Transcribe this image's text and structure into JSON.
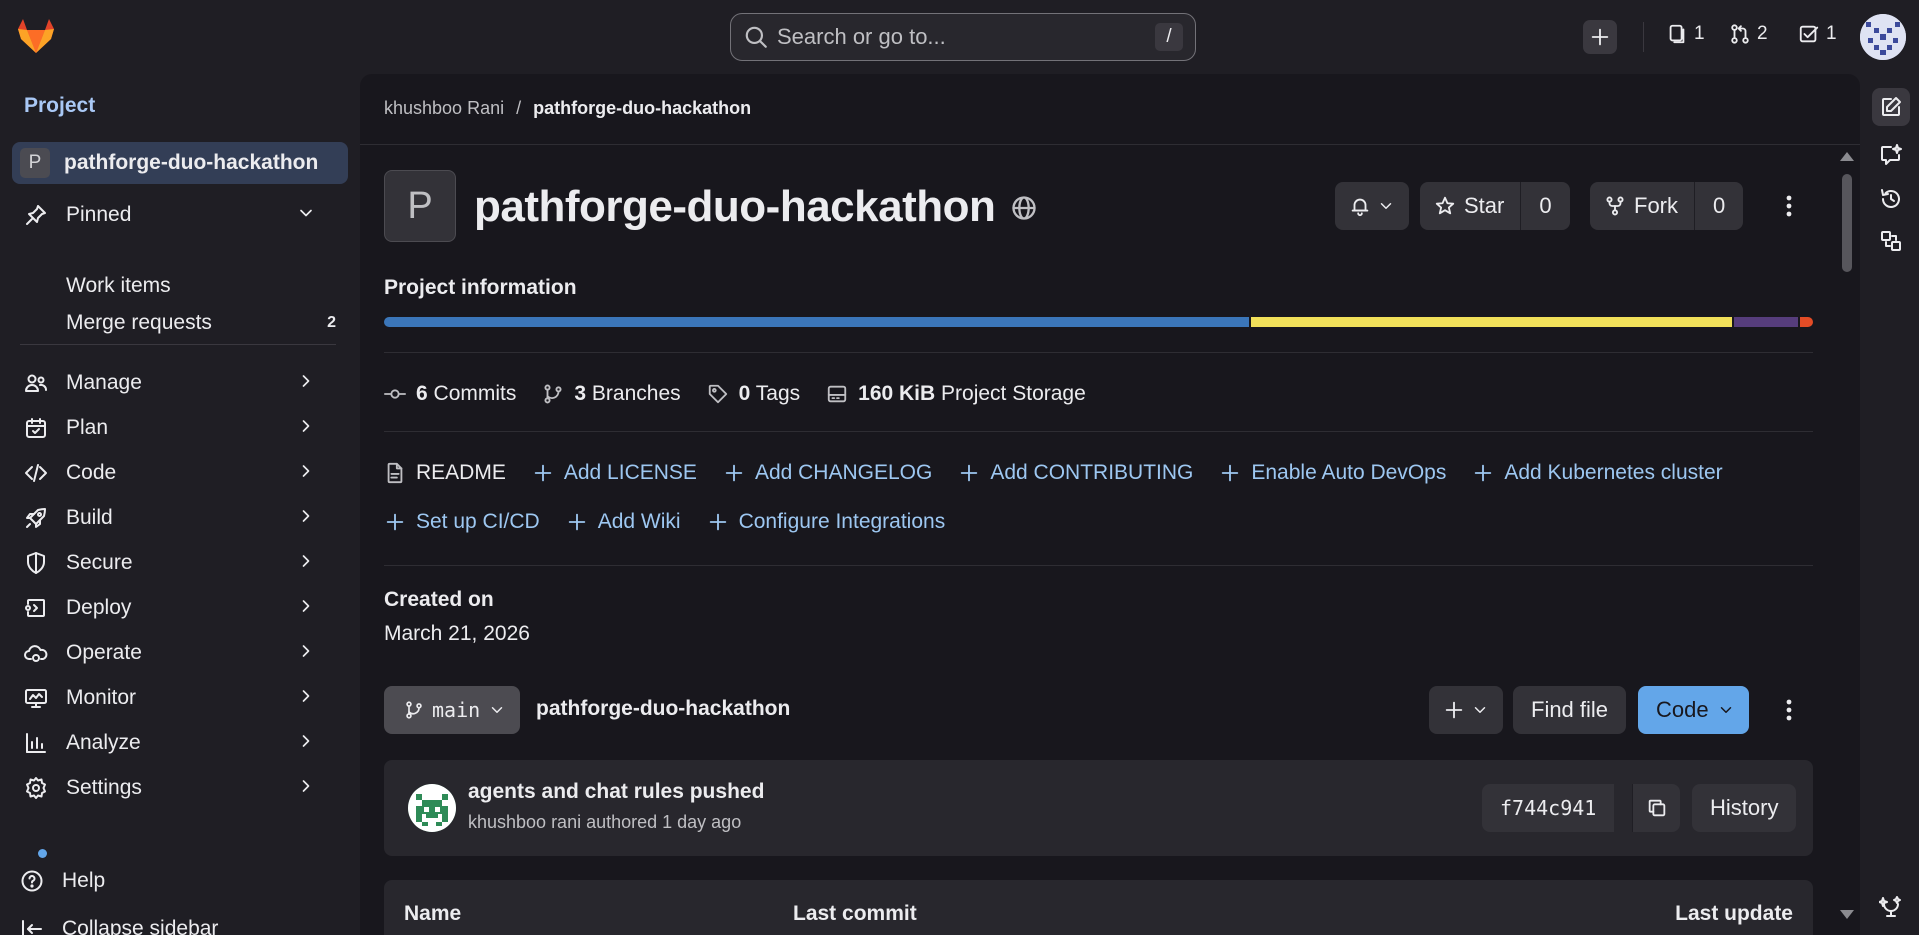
{
  "topbar": {
    "search_placeholder": "Search or go to...",
    "search_shortcut": "/",
    "issues_count": "1",
    "merge_requests_count": "2",
    "todos_count": "1"
  },
  "sidebar": {
    "heading": "Project",
    "project_name": "pathforge-duo-hackathon",
    "project_initial": "P",
    "pinned": {
      "label": "Pinned",
      "items": [
        {
          "label": "Work items",
          "count": ""
        },
        {
          "label": "Merge requests",
          "count": "2"
        }
      ]
    },
    "nav": [
      {
        "label": "Manage",
        "icon": "users-icon"
      },
      {
        "label": "Plan",
        "icon": "calendar-icon"
      },
      {
        "label": "Code",
        "icon": "code-icon"
      },
      {
        "label": "Build",
        "icon": "rocket-icon"
      },
      {
        "label": "Secure",
        "icon": "shield-icon"
      },
      {
        "label": "Deploy",
        "icon": "deploy-icon"
      },
      {
        "label": "Operate",
        "icon": "cloud-gear-icon"
      },
      {
        "label": "Monitor",
        "icon": "monitor-icon"
      },
      {
        "label": "Analyze",
        "icon": "chart-icon"
      },
      {
        "label": "Settings",
        "icon": "gear-icon"
      }
    ],
    "help": "Help",
    "collapse": "Collapse sidebar"
  },
  "breadcrumb": {
    "owner": "khushboo Rani",
    "separator": "/",
    "project": "pathforge-duo-hackathon"
  },
  "project": {
    "initial": "P",
    "title": "pathforge-duo-hackathon",
    "star_label": "Star",
    "star_count": "0",
    "fork_label": "Fork",
    "fork_count": "0",
    "info_label": "Project information",
    "languages": [
      {
        "share": 61,
        "color": "#3b76b9"
      },
      {
        "share": 34,
        "color": "#f1e05a"
      },
      {
        "share": 4.5,
        "color": "#563d7c"
      },
      {
        "share": 0.9,
        "color": "#e34c26"
      }
    ],
    "stats": [
      {
        "icon": "commit-icon",
        "value": "6",
        "label": "Commits"
      },
      {
        "icon": "branch-icon",
        "value": "3",
        "label": "Branches"
      },
      {
        "icon": "tag-icon",
        "value": "0",
        "label": "Tags"
      },
      {
        "icon": "storage-icon",
        "value": "160 KiB",
        "label": "Project Storage"
      }
    ],
    "quick_links_row1": [
      {
        "label": "README",
        "icon": "file-icon",
        "plain": true
      },
      {
        "label": "Add LICENSE",
        "icon": "plus-icon"
      },
      {
        "label": "Add CHANGELOG",
        "icon": "plus-icon"
      },
      {
        "label": "Add CONTRIBUTING",
        "icon": "plus-icon"
      },
      {
        "label": "Enable Auto DevOps",
        "icon": "plus-icon"
      },
      {
        "label": "Add Kubernetes cluster",
        "icon": "plus-icon"
      }
    ],
    "quick_links_row2": [
      {
        "label": "Set up CI/CD",
        "icon": "plus-icon"
      },
      {
        "label": "Add Wiki",
        "icon": "plus-icon"
      },
      {
        "label": "Configure Integrations",
        "icon": "plus-icon"
      }
    ],
    "created_label": "Created on",
    "created_date": "March 21, 2026"
  },
  "repo": {
    "branch": "main",
    "name": "pathforge-duo-hackathon",
    "find_file": "Find file",
    "code_button": "Code"
  },
  "last_commit": {
    "title": "agents and chat rules pushed",
    "meta": "khushboo rani authored 1 day ago",
    "sha": "f744c941",
    "history": "History"
  },
  "file_table": {
    "columns": [
      "Name",
      "Last commit",
      "Last update"
    ]
  },
  "colors": {
    "accent": "#63a6e9",
    "link": "#9dc7f1",
    "sidebar_active": "#333e56"
  }
}
